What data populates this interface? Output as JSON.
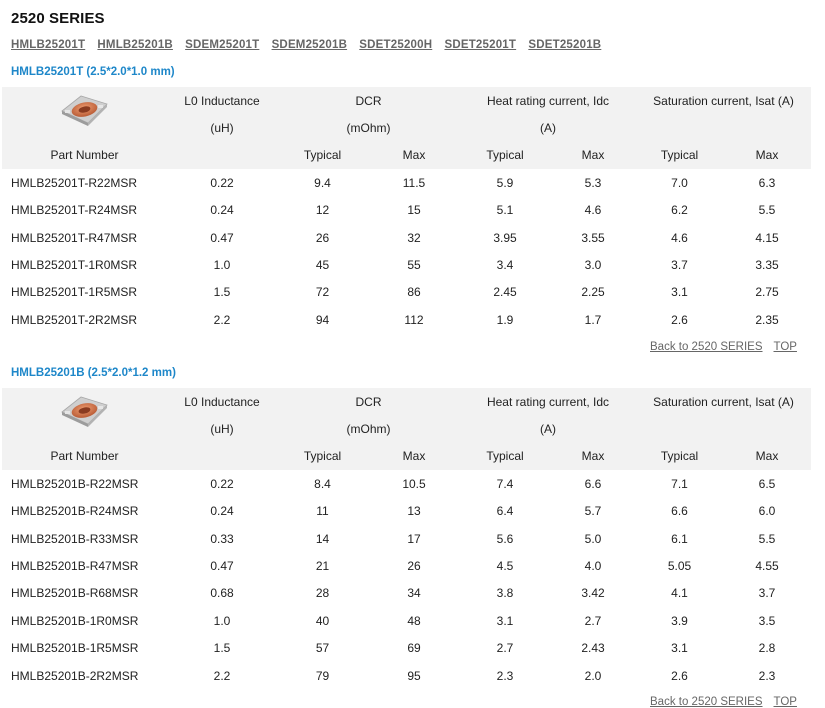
{
  "series_title": "2520 SERIES",
  "nav_links": [
    "HMLB25201T",
    "HMLB25201B",
    "SDEM25201T",
    "SDEM25201B",
    "SDET25200H",
    "SDET25201T",
    "SDET25201B"
  ],
  "header": {
    "part_number": "Part Number",
    "inductance": "L0 Inductance",
    "inductance_unit": "(uH)",
    "dcr": "DCR",
    "dcr_unit": "(mOhm)",
    "heat_current": "Heat rating current, Idc",
    "heat_unit": "(A)",
    "sat_current": "Saturation current, Isat (A)",
    "typical": "Typical",
    "max": "Max"
  },
  "back_link": "Back to 2520 SERIES",
  "top_link": "TOP",
  "sections": [
    {
      "title": "HMLB25201T (2.5*2.0*1.0 mm)",
      "rows": [
        [
          "HMLB25201T-R22MSR",
          "0.22",
          "9.4",
          "11.5",
          "5.9",
          "5.3",
          "7.0",
          "6.3"
        ],
        [
          "HMLB25201T-R24MSR",
          "0.24",
          "12",
          "15",
          "5.1",
          "4.6",
          "6.2",
          "5.5"
        ],
        [
          "HMLB25201T-R47MSR",
          "0.47",
          "26",
          "32",
          "3.95",
          "3.55",
          "4.6",
          "4.15"
        ],
        [
          "HMLB25201T-1R0MSR",
          "1.0",
          "45",
          "55",
          "3.4",
          "3.0",
          "3.7",
          "3.35"
        ],
        [
          "HMLB25201T-1R5MSR",
          "1.5",
          "72",
          "86",
          "2.45",
          "2.25",
          "3.1",
          "2.75"
        ],
        [
          "HMLB25201T-2R2MSR",
          "2.2",
          "94",
          "112",
          "1.9",
          "1.7",
          "2.6",
          "2.35"
        ]
      ]
    },
    {
      "title": "HMLB25201B (2.5*2.0*1.2 mm)",
      "rows": [
        [
          "HMLB25201B-R22MSR",
          "0.22",
          "8.4",
          "10.5",
          "7.4",
          "6.6",
          "7.1",
          "6.5"
        ],
        [
          "HMLB25201B-R24MSR",
          "0.24",
          "11",
          "13",
          "6.4",
          "5.7",
          "6.6",
          "6.0"
        ],
        [
          "HMLB25201B-R33MSR",
          "0.33",
          "14",
          "17",
          "5.6",
          "5.0",
          "6.1",
          "5.5"
        ],
        [
          "HMLB25201B-R47MSR",
          "0.47",
          "21",
          "26",
          "4.5",
          "4.0",
          "5.05",
          "4.55"
        ],
        [
          "HMLB25201B-R68MSR",
          "0.68",
          "28",
          "34",
          "3.8",
          "3.42",
          "4.1",
          "3.7"
        ],
        [
          "HMLB25201B-1R0MSR",
          "1.0",
          "40",
          "48",
          "3.1",
          "2.7",
          "3.9",
          "3.5"
        ],
        [
          "HMLB25201B-1R5MSR",
          "1.5",
          "57",
          "69",
          "2.7",
          "2.43",
          "3.1",
          "2.8"
        ],
        [
          "HMLB25201B-2R2MSR",
          "2.2",
          "79",
          "95",
          "2.3",
          "2.0",
          "2.6",
          "2.3"
        ]
      ]
    }
  ]
}
